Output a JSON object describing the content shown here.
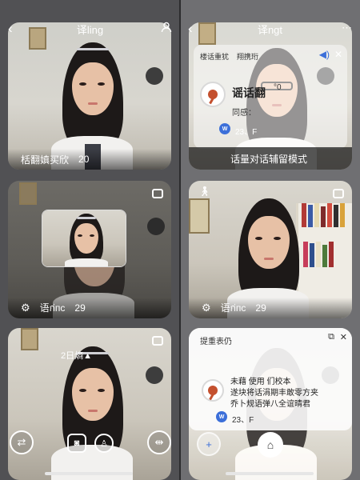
{
  "left_column": {
    "top_card": {
      "back_icon": "chevron-left-icon",
      "title": "译ling",
      "profile_icon": "person-icon",
      "caption_text": "栝翻嫃买欣",
      "caption_value": "20"
    },
    "middle_card": {
      "corner_icon": "camera-switch-icon",
      "caption_icon": "gear-icon",
      "caption_text": "语ก่пс",
      "caption_value": "29"
    },
    "bottom_card": {
      "corner_icon": "camera-switch-icon",
      "overlay_text": "2日熵▲",
      "toolbar": {
        "left_button_icon": "swap-icon",
        "center_button_1_icon": "robot-icon",
        "center_button_2_icon": "person-badge-icon",
        "right_button_icon": "split-icon"
      }
    }
  },
  "right_column": {
    "top_card": {
      "back_icon": "chevron-left-icon",
      "title": "译ngt",
      "more_icon": "more-icon",
      "panel": {
        "header_left": "楼话重犹",
        "header_right": "翔携珩",
        "speaker_icon": "speaker-icon",
        "close_icon": "close-icon",
        "name": "谣话翻",
        "name_suffix": "°0",
        "sub_text": "同感：",
        "badge": "W",
        "count": "23、F"
      },
      "bar_text": "话量对话辅留模式"
    },
    "middle_card": {
      "left_icon": "walk-icon",
      "corner_icon": "camera-switch-icon",
      "caption_icon": "gear-icon",
      "caption_text": "语ก่пс",
      "caption_value": "29"
    },
    "bottom_card": {
      "panel": {
        "header": "提重表仍",
        "copy_icon": "copy-icon",
        "close_icon": "close-icon",
        "line1": "未藉  使用  们校本",
        "line2": "遂块将话涓期丰敢零方夹",
        "line3": "乔卜规语弹八全谊晴君",
        "badge": "W",
        "count": "23、F"
      },
      "toolbar": {
        "left_button_icon": "add-icon",
        "home_button_icon": "home-icon"
      }
    }
  }
}
